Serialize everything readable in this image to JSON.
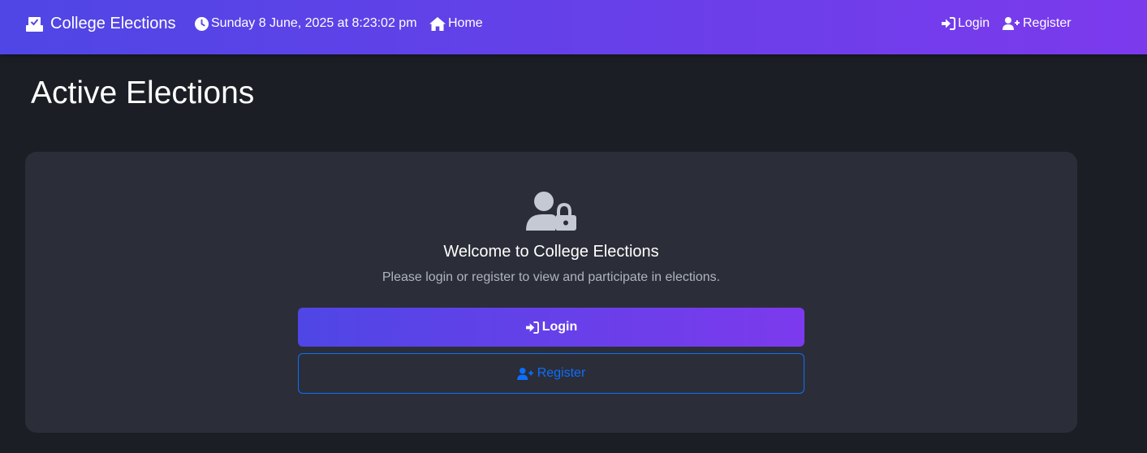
{
  "navbar": {
    "brand": "College Elections",
    "datetime": "Sunday 8 June, 2025 at 8:23:02 pm",
    "home": "Home",
    "login": "Login",
    "register": "Register",
    "icons": {
      "brand": "ballot-box-icon",
      "clock": "clock-icon",
      "home": "home-icon",
      "login": "sign-in-icon",
      "register": "user-plus-icon"
    }
  },
  "main": {
    "title": "Active Elections",
    "card": {
      "icon": "user-lock-icon",
      "heading": "Welcome to College Elections",
      "text": "Please login or register to view and participate in elections.",
      "login_button": "Login",
      "register_button": "Register"
    }
  },
  "colors": {
    "gradient_start": "#4f46e5",
    "gradient_end": "#7c3aed",
    "background": "#1b1e25",
    "card": "#2b2e38",
    "outline_blue": "#0d6efd"
  }
}
